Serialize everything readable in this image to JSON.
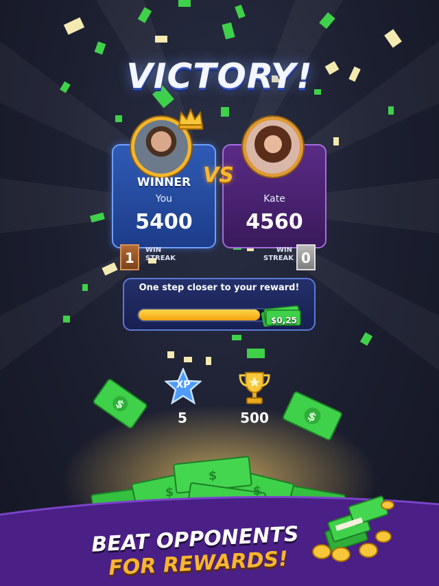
{
  "title": "VICTORY!",
  "vs_label": "VS",
  "player_left": {
    "tag": "WINNER",
    "name": "You",
    "score": "5400",
    "streak_value": "1",
    "streak_label_1": "WIN",
    "streak_label_2": "STREAK"
  },
  "player_right": {
    "name": "Kate",
    "score": "4560",
    "streak_value": "0",
    "streak_label_1": "WIN",
    "streak_label_2": "STREAK"
  },
  "reward": {
    "message": "One step closer to your reward!",
    "progress_fraction": 0.85,
    "amount": "$0,25"
  },
  "stats": {
    "xp_label": "XP",
    "xp_value": "5",
    "trophy_value": "500"
  },
  "promo": {
    "line1": "BEAT OPPONENTS",
    "line2": "FOR REWARDS!"
  },
  "colors": {
    "background": "#1b1e2e",
    "accent_gold": "#f7b531",
    "cash_green": "#3fd14a",
    "winner_blue": "#2f5bb5",
    "loser_purple": "#5a2b86",
    "promo_purple": "#4a1f86"
  },
  "icons": [
    "crown-icon",
    "xp-star-icon",
    "trophy-icon",
    "cash-stack-icon",
    "coin-icon"
  ]
}
